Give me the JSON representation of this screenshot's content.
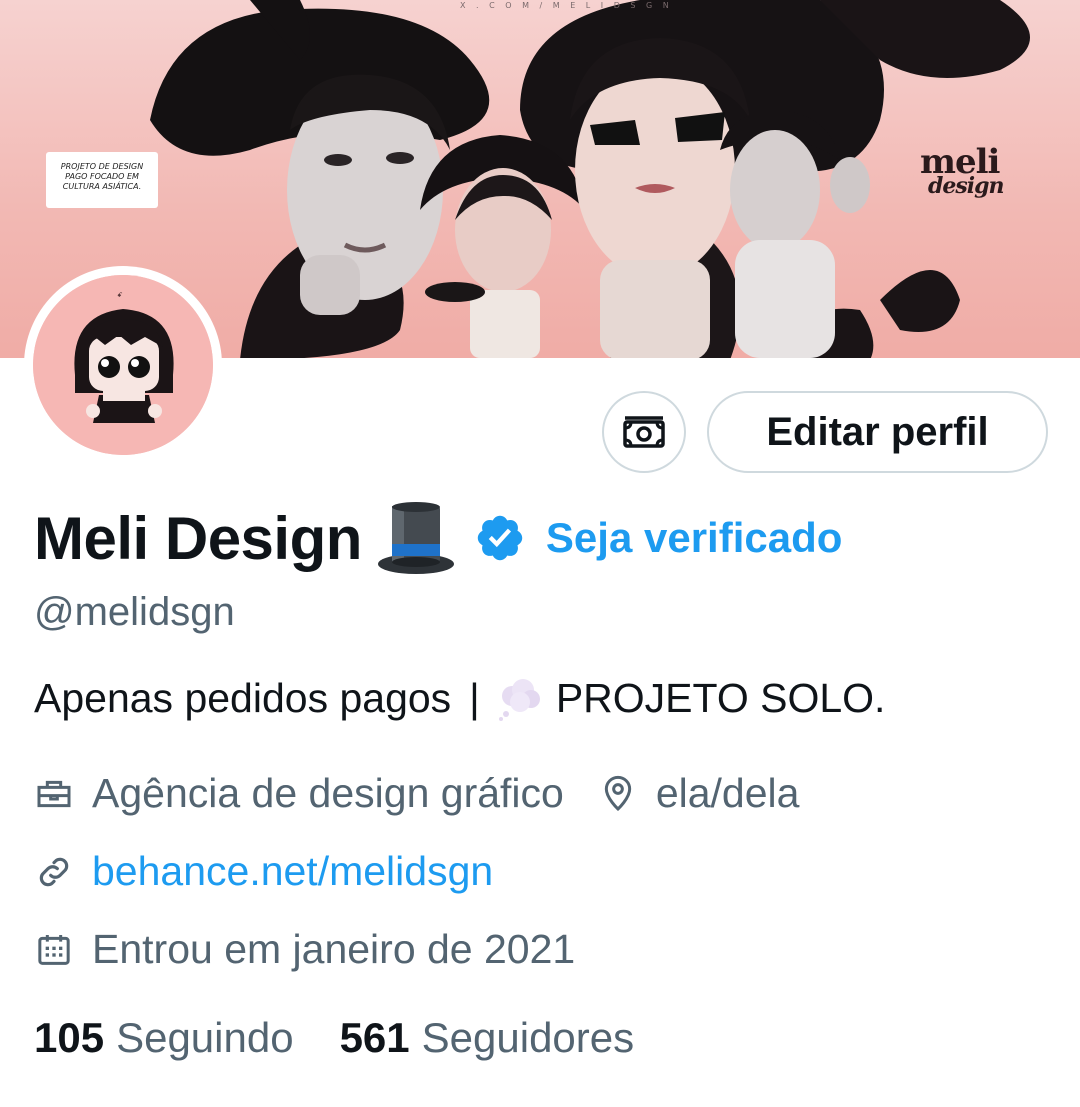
{
  "banner": {
    "caption": "PROJETO DE DESIGN PAGO FOCADO EM CULTURA ASIÁTICA.",
    "brand_line1": "meli",
    "brand_line2": "design"
  },
  "actions": {
    "tip_icon": "money-icon",
    "edit_label": "Editar perfil"
  },
  "profile": {
    "display_name": "Meli Design",
    "name_emoji": "top-hat-icon",
    "verified_icon": "verified-badge-icon",
    "verify_link": "Seja verificado",
    "handle": "@melidsgn",
    "bio_text": "Apenas pedidos pagos",
    "bio_separator": "|",
    "bio_emoji": "thought-cloud-icon",
    "bio_text2": "PROJETO SOLO.",
    "category": "Agência de design gráfico",
    "location": "ela/dela",
    "website": "behance.net/melidsgn",
    "joined": "Entrou em janeiro de 2021"
  },
  "stats": {
    "following_count": "105",
    "following_label": "Seguindo",
    "followers_count": "561",
    "followers_label": "Seguidores"
  },
  "colors": {
    "accent": "#1d9bf0",
    "secondary_text": "#536471",
    "primary_text": "#0f1419",
    "border": "#cfd9de",
    "banner_pink": "#f2b8b3"
  }
}
